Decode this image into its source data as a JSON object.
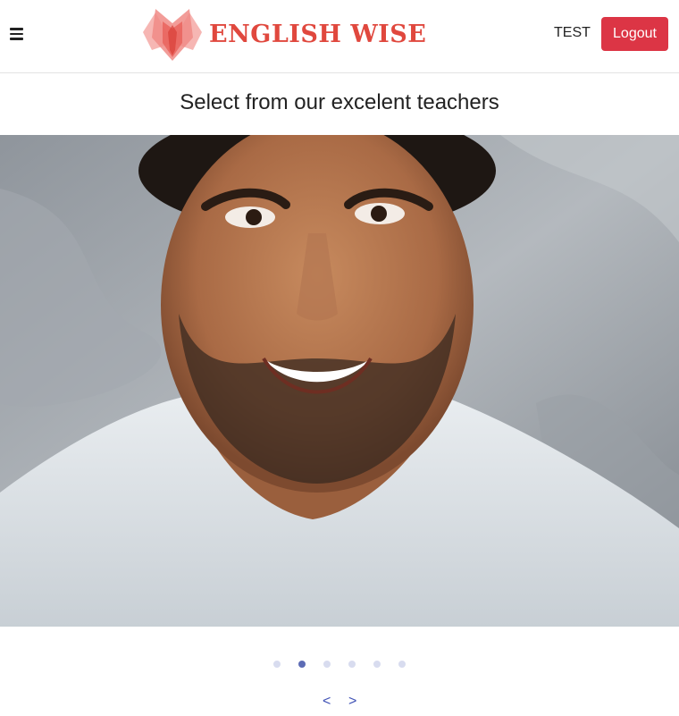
{
  "header": {
    "menu_icon": "hamburger-icon",
    "logo_icon": "lotus-logo-icon",
    "brand": "ENGLISH WISE",
    "user": "TEST",
    "logout_label": "Logout"
  },
  "main": {
    "headline": "Select from our excelent teachers"
  },
  "carousel": {
    "dots_count": 6,
    "active_index": 1,
    "prev_label": "<",
    "next_label": ">"
  },
  "colors": {
    "brand": "#e0483e",
    "logout": "#dc3545",
    "carousel_active": "#5d6cb5",
    "carousel_inactive": "#d8dcef"
  }
}
